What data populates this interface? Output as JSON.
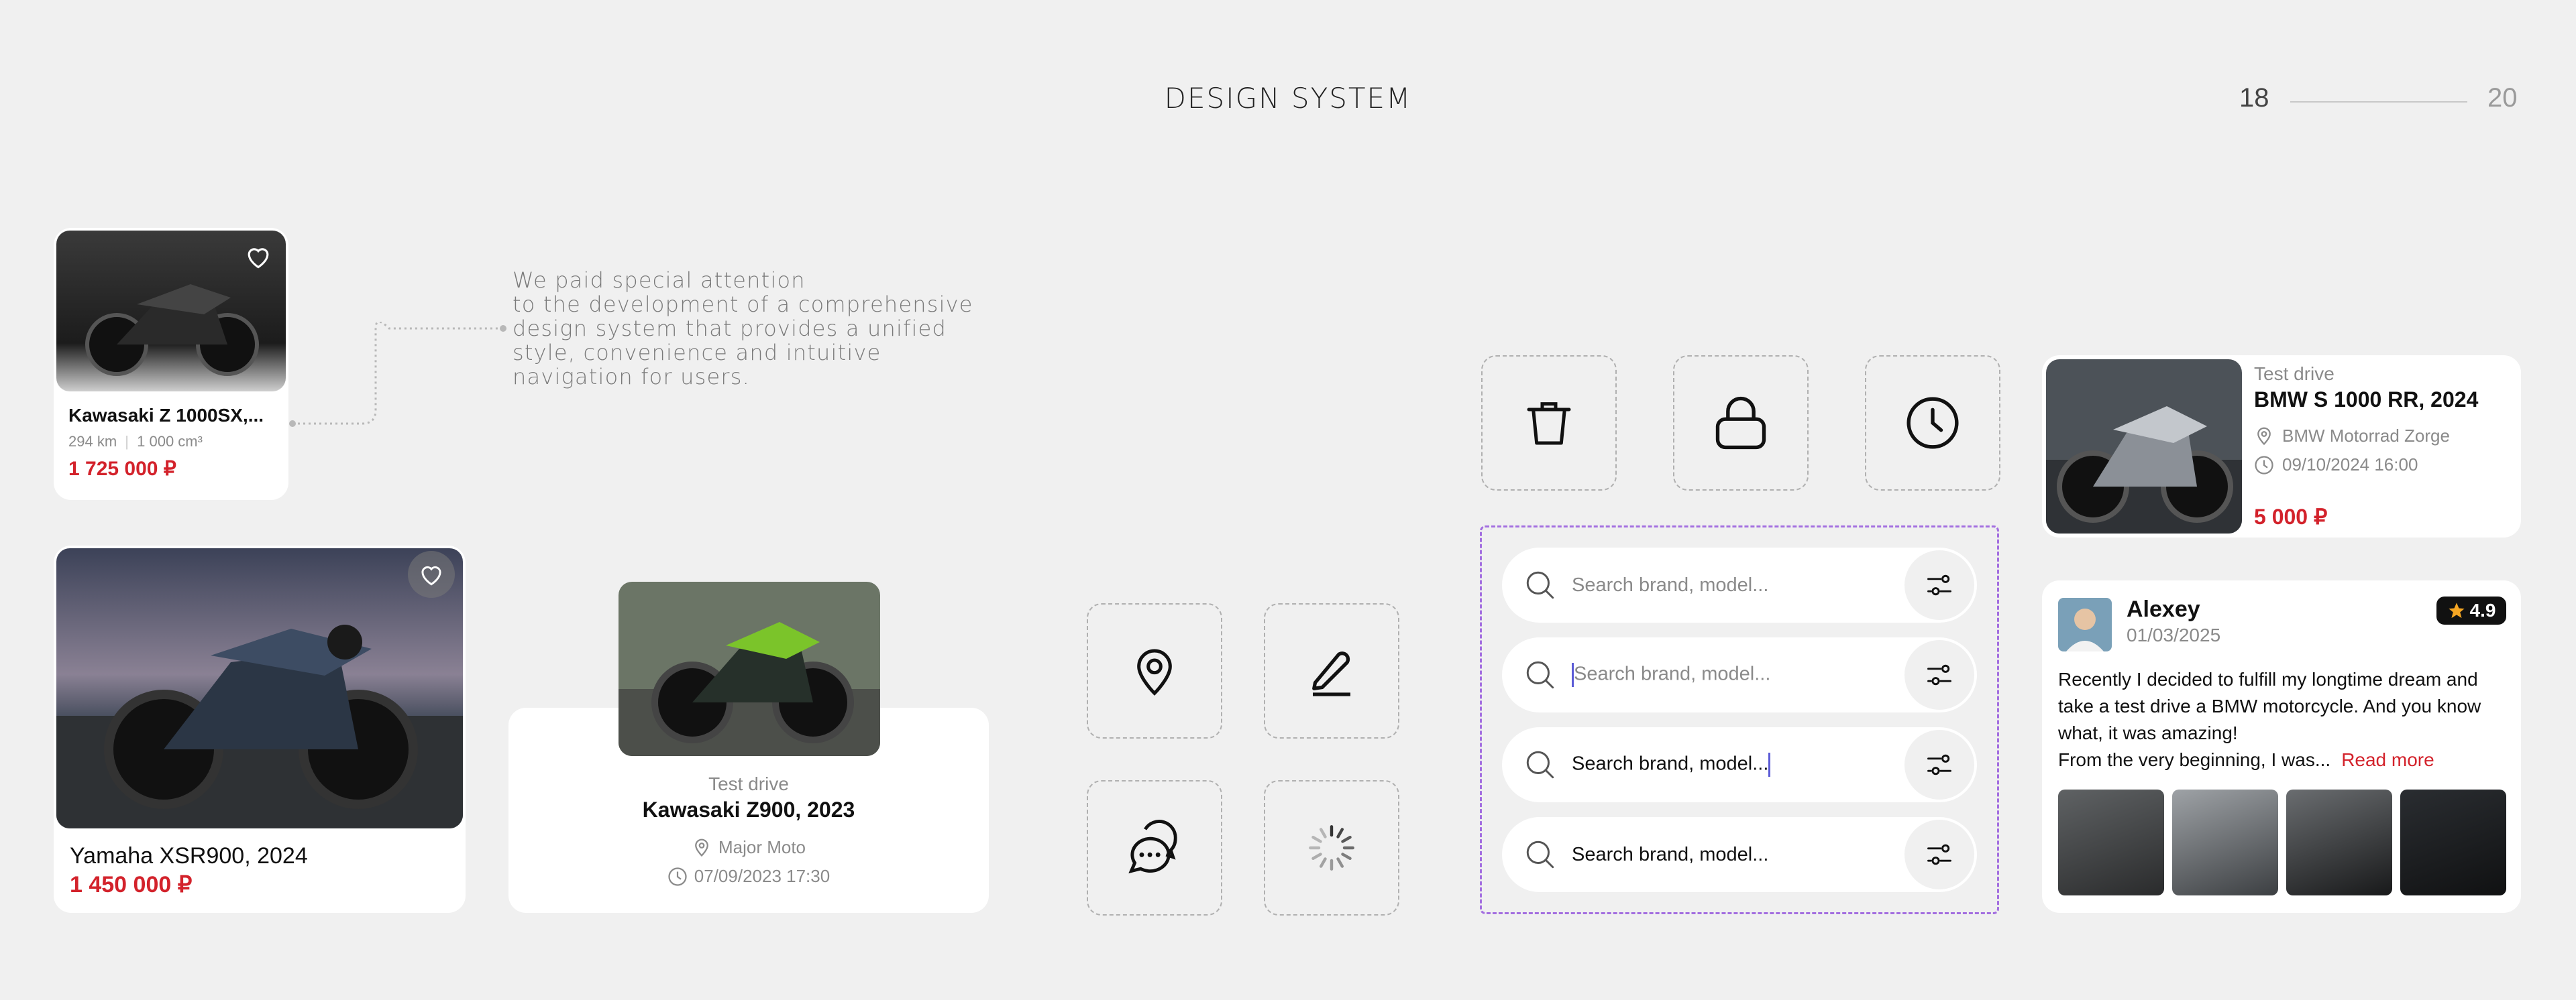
{
  "header": {
    "title": "DESIGN SYSTEM",
    "page_current": "18",
    "page_total": "20"
  },
  "description": {
    "line1": "We paid special attention",
    "line2": "to the development of a comprehensive",
    "line3": "design system that provides a unified",
    "line4": "style, convenience and intuitive",
    "line5": "navigation for users."
  },
  "card_small": {
    "name": "Kawasaki Z 1000SX,...",
    "mileage": "294 km",
    "volume": "1 000 cm³",
    "price": "1 725 000 ₽"
  },
  "card_large": {
    "name": "Yamaha XSR900, 2024",
    "price": "1 450 000 ₽"
  },
  "card_testdrive_center": {
    "label": "Test drive",
    "name": "Kawasaki Z900, 2023",
    "location": "Major Moto",
    "datetime": "07/09/2023 17:30"
  },
  "icons": {
    "tiles": [
      "location-pin-icon",
      "pencil-icon",
      "chat-icon",
      "spinner-icon",
      "trash-icon",
      "lock-icon",
      "clock-icon"
    ]
  },
  "search": {
    "placeholder": "Search brand, model...",
    "typed_value": "Search brand, model...",
    "filled_value": "Search brand, model..."
  },
  "card_testdrive_right": {
    "label": "Test drive",
    "name": "BMW S 1000 RR, 2024",
    "location": "BMW Motorrad Zorge",
    "datetime": "09/10/2024 16:00",
    "price": "5 000 ₽"
  },
  "review": {
    "author": "Alexey",
    "date": "01/03/2025",
    "rating": "4.9",
    "line1": "Recently I decided to fulfill my longtime dream and",
    "line2": "take a test drive a BMW motorcycle. And you know",
    "line3": "what, it was amazing!",
    "line4": "From the very beginning, I was...",
    "read_more": "Read more"
  },
  "colors": {
    "accent_red": "#d3222b",
    "focus_purple": "#a36ee0",
    "star": "#f5a623"
  }
}
